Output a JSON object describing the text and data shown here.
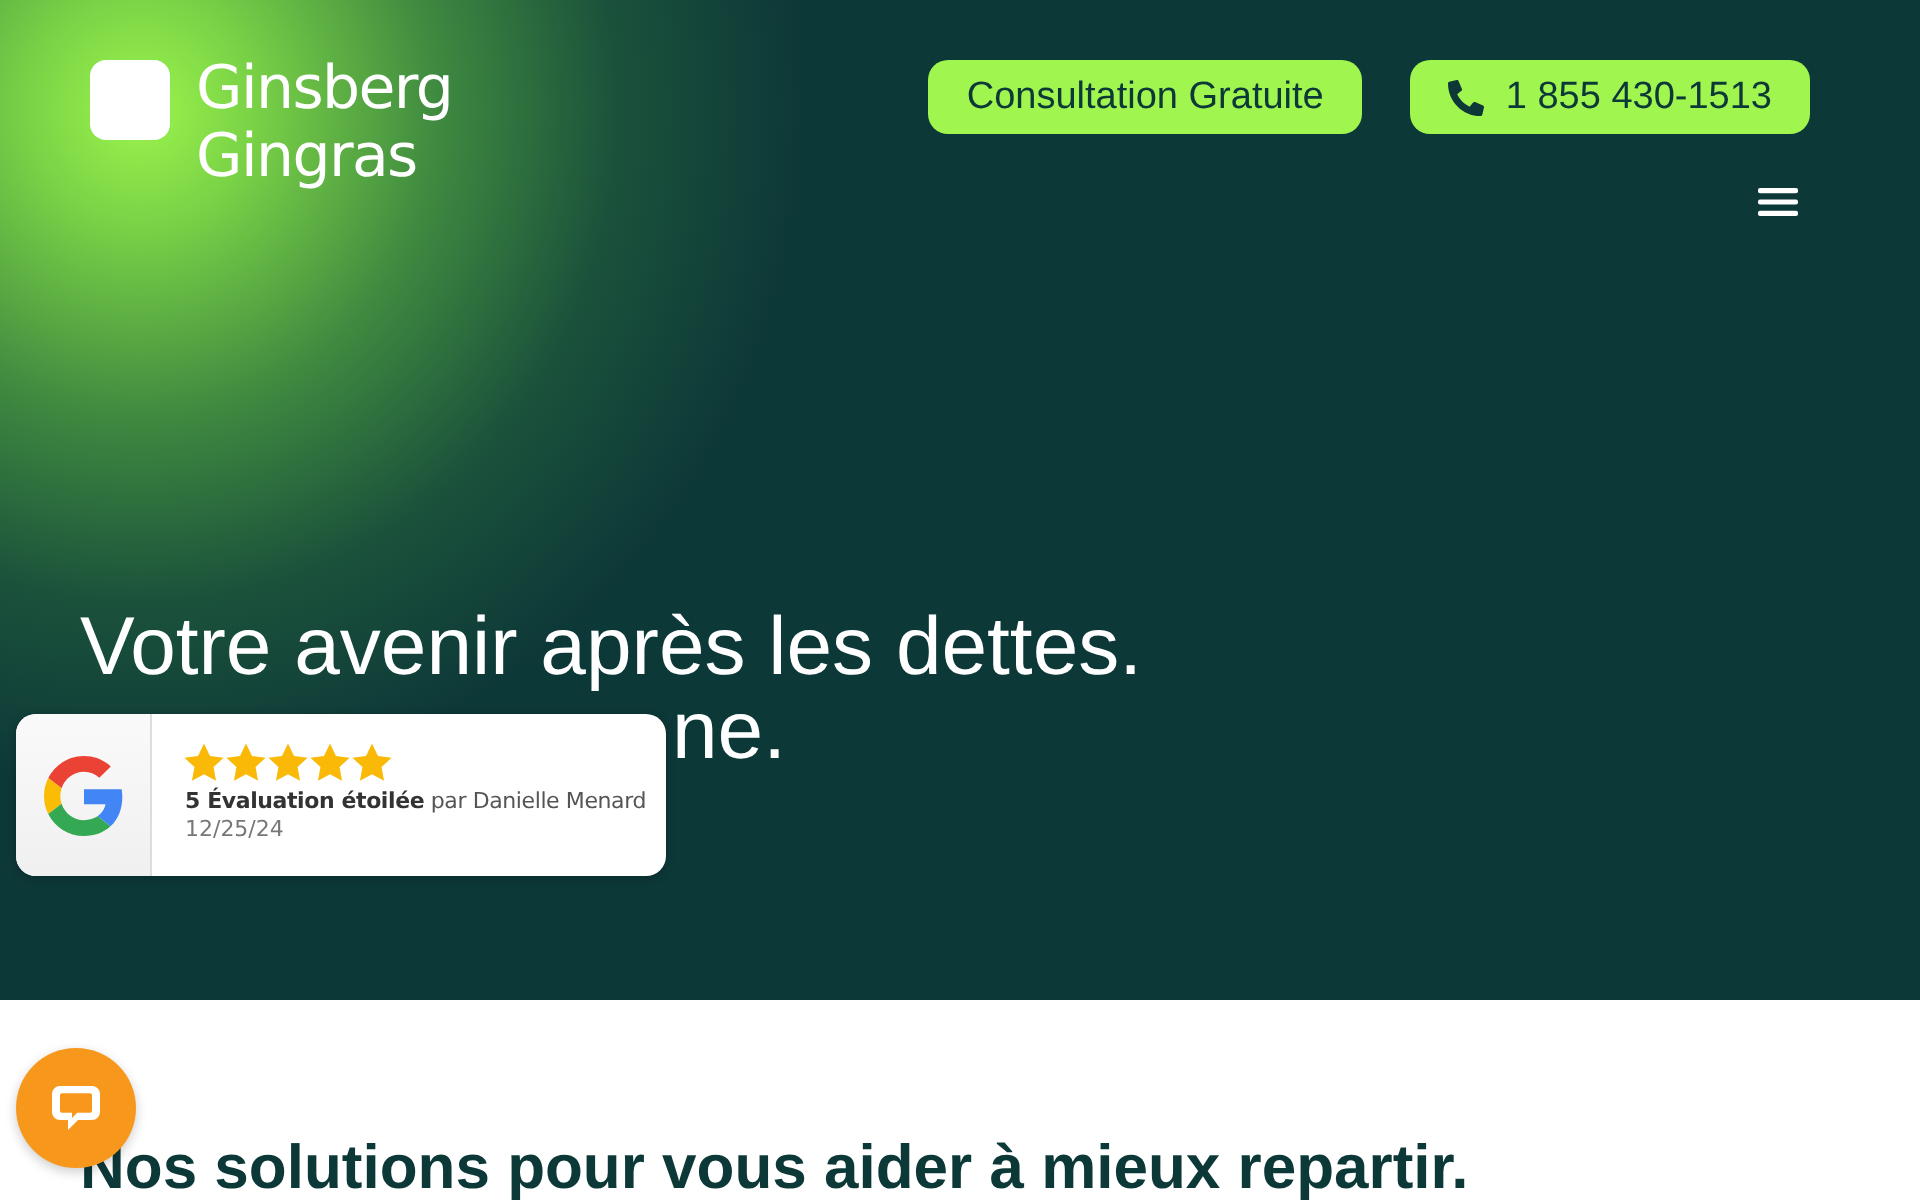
{
  "header": {
    "logo": {
      "lines": [
        "Ginsberg",
        "Gingras"
      ]
    },
    "buttons": [
      {
        "kind": "text",
        "label": "Consultation Gratuite"
      },
      {
        "kind": "phone",
        "label": "1 855 430-1513"
      }
    ]
  },
  "hero": {
    "headline": [
      "Votre avenir après les dettes.",
      "ne."
    ]
  },
  "review": {
    "stars": 5,
    "text": "**5 Évaluation étoilée** par Danielle Menard",
    "date": "12/25/24"
  },
  "section": {
    "heading": "Nos solutions pour vous aider à mieux repartir."
  }
}
